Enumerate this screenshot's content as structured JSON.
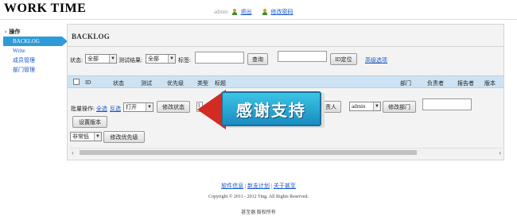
{
  "app": {
    "title": "WORK TIME"
  },
  "userbar": {
    "username": "admin",
    "logout": "退出",
    "change_password": "修改密码"
  },
  "sidebar": {
    "section": "操作",
    "items": [
      {
        "label": "BACKLOG",
        "active": true
      },
      {
        "label": "Write",
        "active": false
      },
      {
        "label": "成员管理",
        "active": false
      },
      {
        "label": "部门管理",
        "active": false
      }
    ]
  },
  "panel": {
    "title": "BACKLOG"
  },
  "filters": {
    "status_label": "状态:",
    "status_value": "全部",
    "test_result_label": "测试结果:",
    "test_result_value": "全部",
    "tag_label": "标签:",
    "tag_value": "",
    "search_button": "查询",
    "id_value": "",
    "id_locate_button": "ID定位",
    "advanced_link": "高级选项"
  },
  "table": {
    "columns": [
      "ID",
      "状态",
      "测试",
      "优先级",
      "类型",
      "标题",
      "部门",
      "负责者",
      "报告者",
      "版本"
    ]
  },
  "batch": {
    "label": "批量操作:",
    "select_all": "全选",
    "invert": "反选",
    "status_select": "打开",
    "modify_status_button": "修改状态",
    "assignee_button_partial": "责人",
    "dept_select": "admin",
    "modify_dept_button": "修改部门",
    "version_value": "",
    "set_version_button": "设置版本",
    "priority_select": "非常低",
    "modify_priority_button": "修改优先级",
    "hidden_input_partial": "I"
  },
  "overlay": {
    "text": "感谢支持"
  },
  "footer": {
    "links": [
      "软件信息",
      "新支计划",
      "关于甚至"
    ],
    "copyright": "Copyright © 2011 - 2012 Ting. All Rights Reserved.",
    "owner": "甚至器 版权所有"
  },
  "colors": {
    "accent": "#2e9bd8",
    "table_header": "#cde3f3",
    "link": "#1a56c8",
    "overlay_arrow": "#d22b24",
    "overlay_box": "#1a8cbf"
  }
}
